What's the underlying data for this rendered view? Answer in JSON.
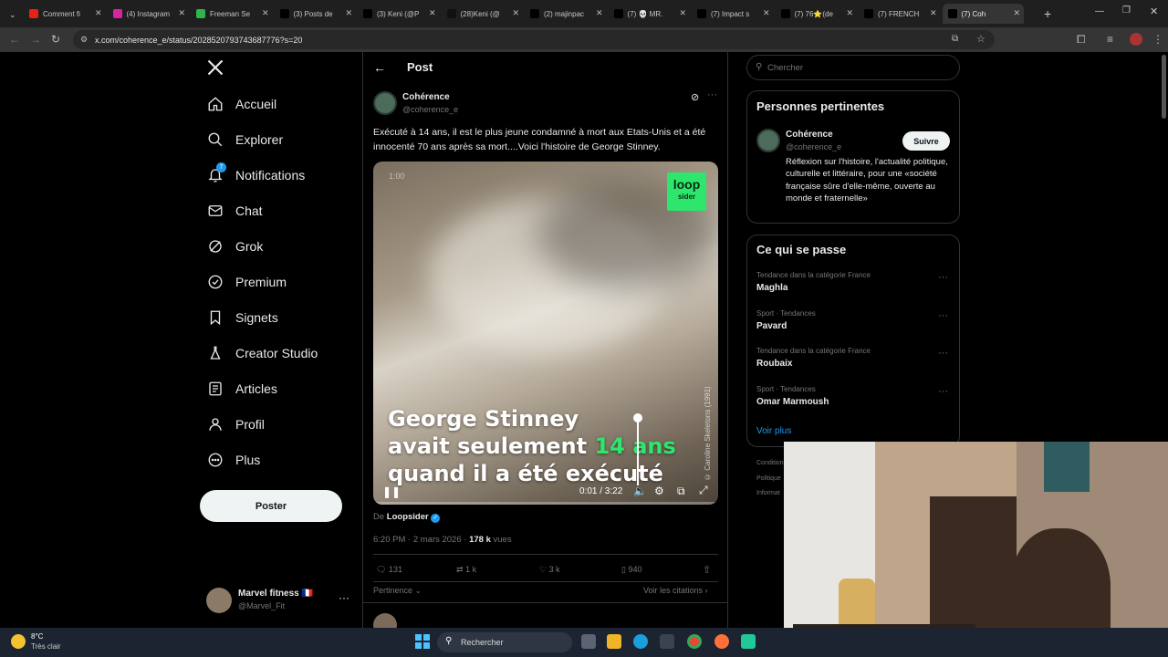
{
  "browser": {
    "tabs": [
      {
        "label": "Comment fi",
        "color": "#e62117"
      },
      {
        "label": "(4) Instagram",
        "color": "#d6249f"
      },
      {
        "label": "Freeman Se",
        "color": "#2fb34a"
      },
      {
        "label": "(3) Posts de",
        "color": "#000000"
      },
      {
        "label": "(3) Keni (@P",
        "color": "#000000"
      },
      {
        "label": "(28)Keni (@",
        "color": "#111111"
      },
      {
        "label": "(2) majinpac",
        "color": "#000000"
      },
      {
        "label": "(7) 💀 MR.",
        "color": "#000000"
      },
      {
        "label": "(7) Impact s",
        "color": "#000000"
      },
      {
        "label": "(7) 76⭐(de",
        "color": "#000000"
      },
      {
        "label": "(7) FRENCH",
        "color": "#000000"
      },
      {
        "label": "(7) Coh",
        "color": "#000000"
      }
    ],
    "new_tab": "+",
    "url": "x.com/coherence_e/status/2028520793743687776?s=20"
  },
  "nav": {
    "items": [
      {
        "label": "Accueil",
        "icon": "home-icon"
      },
      {
        "label": "Explorer",
        "icon": "search-icon"
      },
      {
        "label": "Notifications",
        "icon": "bell-icon",
        "badge": "7"
      },
      {
        "label": "Chat",
        "icon": "mail-icon"
      },
      {
        "label": "Grok",
        "icon": "grok-icon"
      },
      {
        "label": "Premium",
        "icon": "verified-icon"
      },
      {
        "label": "Signets",
        "icon": "bookmark-icon"
      },
      {
        "label": "Creator Studio",
        "icon": "flask-icon"
      },
      {
        "label": "Articles",
        "icon": "article-icon"
      },
      {
        "label": "Profil",
        "icon": "person-icon"
      },
      {
        "label": "Plus",
        "icon": "more-circle-icon"
      }
    ],
    "post_button": "Poster",
    "account": {
      "name": "Marvel fitness 🇫🇷",
      "handle": "@Marvel_Fit"
    }
  },
  "post": {
    "header_title": "Post",
    "author_name": "Cohérence",
    "author_handle": "@coherence_e",
    "text": "Exécuté à 14 ans, il est le plus jeune condamné à mort aux Etats-Unis et a été innocenté 70 ans après sa mort....Voici l'histoire de George Stinney.",
    "video": {
      "badge_time": "1:00",
      "logo_top": "loop",
      "logo_bottom": "sider",
      "caption_line1": "George Stinney",
      "caption_line2a": "avait seulement ",
      "caption_line2b": "14 ans",
      "caption_line3": "quand il a été exécuté",
      "side_credit": "© Caroline Skeletons (1991)",
      "time": "0:01 / 3:22",
      "progress": 0.005,
      "accent": "#2ee66b"
    },
    "source_prefix": "De ",
    "source_name": "Loopsider",
    "meta_time": "6:20 PM · 2 mars 2026 · ",
    "views_count": "178 k",
    "views_label": " vues",
    "stats": {
      "replies": "131",
      "reposts": "1 k",
      "likes": "3 k",
      "bookmarks": "940"
    },
    "sort_label": "Pertinence",
    "quotes_label": "Voir les citations"
  },
  "sidebar": {
    "search_placeholder": "Chercher",
    "relevant_title": "Personnes pertinentes",
    "person": {
      "name": "Cohérence",
      "handle": "@coherence_e",
      "follow": "Suivre",
      "bio": "Réflexion sur l'histoire, l'actualité politique, culturelle et littéraire, pour une «société française sûre d'elle-même, ouverte au monde et fraternelle»"
    },
    "trending_title": "Ce qui se passe",
    "trends": [
      {
        "category": "Tendance dans la catégorie France",
        "name": "Maghla"
      },
      {
        "category": "Sport · Tendances",
        "name": "Pavard"
      },
      {
        "category": "Tendance dans la catégorie France",
        "name": "Roubaix"
      },
      {
        "category": "Sport · Tendances",
        "name": "Omar Marmoush"
      }
    ],
    "see_more": "Voir plus",
    "footer": [
      "Condition",
      "Politique",
      "Informat"
    ]
  },
  "taskbar": {
    "temp": "8°C",
    "weather": "Très clair",
    "search": "Rechercher"
  },
  "colors": {
    "accent_blue": "#1d9bf0",
    "border": "#2f3336",
    "muted": "#71767b"
  }
}
